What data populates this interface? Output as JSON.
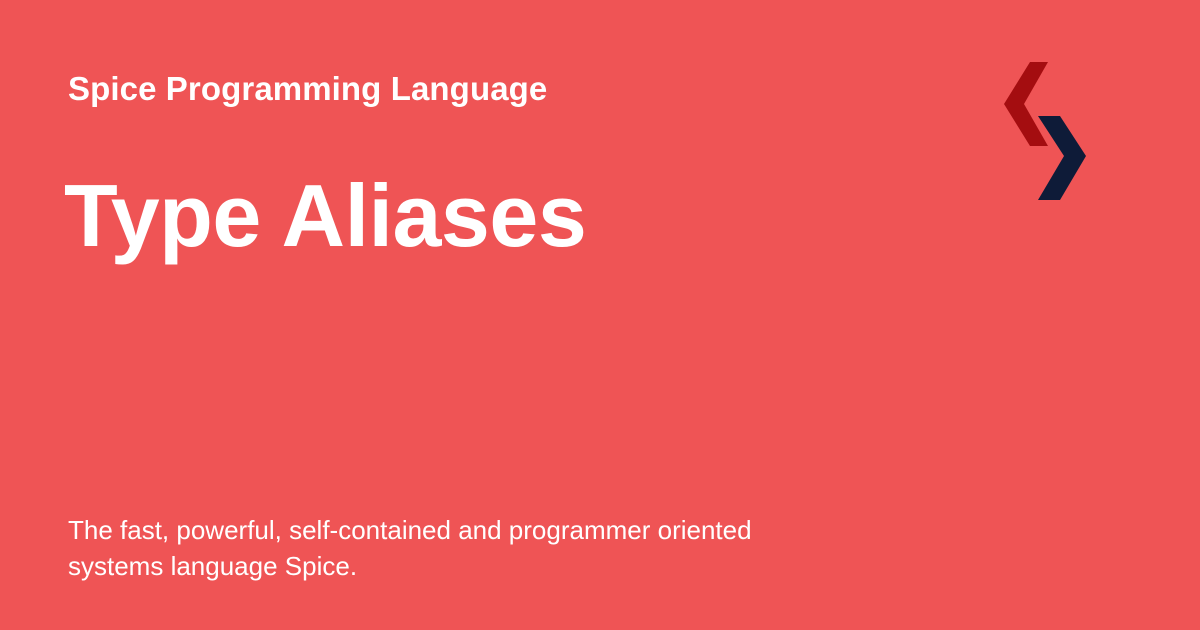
{
  "card": {
    "site_name": "Spice Programming Language",
    "title": "Type Aliases",
    "description_line1": "The fast, powerful, self-contained and programmer oriented",
    "description_line2": "systems language Spice.",
    "logo_icon": "spice-logo-icon"
  },
  "colors": {
    "background": "#ef5455",
    "text": "#ffffff",
    "logo_red": "#a40d10",
    "logo_navy": "#0e1b38"
  }
}
